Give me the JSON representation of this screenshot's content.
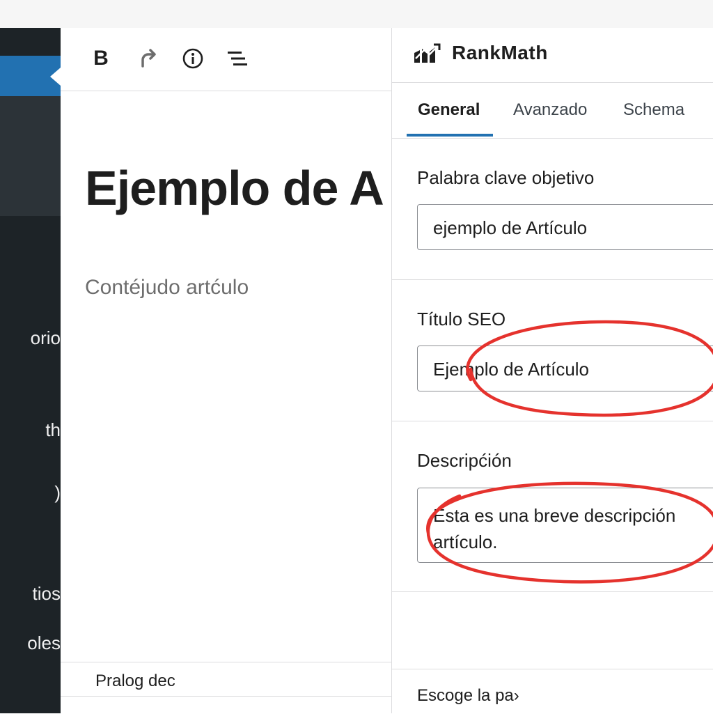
{
  "editor": {
    "toolbar": {
      "bold_label": "B",
      "redo_icon": "redo-icon",
      "info_icon": "info-icon",
      "outline_icon": "list-outline-icon"
    },
    "post_title": "Ejemplo de A",
    "post_body": "Contéjudo artćulo",
    "footer_label": "Pralog dec"
  },
  "sidebar": {
    "items": [
      {
        "label": "orio"
      },
      {
        "label": "th"
      },
      {
        "label": ")"
      },
      {
        "label": "tios"
      },
      {
        "label": "oles"
      }
    ]
  },
  "panel": {
    "title": "RankMath",
    "logo_icon": "rank-math-logo-icon",
    "tabs": [
      {
        "label": "General",
        "active": true
      },
      {
        "label": "Avanzado",
        "active": false
      },
      {
        "label": "Schema",
        "active": false
      }
    ],
    "fields": {
      "keyword": {
        "label": "Palabra clave objetivo",
        "value": "ejemplo de Artículo"
      },
      "seo_title": {
        "label": "Título SEO",
        "value": "Ejemplo de Artículo"
      },
      "description": {
        "label": "Descripćión",
        "line1": "Esta es una breve descripción",
        "line2": "artículo."
      }
    },
    "footer_label": "Escoge la pa›"
  },
  "colors": {
    "sidebar_bg": "#1d2327",
    "sidebar_active": "#2271b1",
    "tab_accent": "#2271b1",
    "annotation": "#e5322d"
  }
}
